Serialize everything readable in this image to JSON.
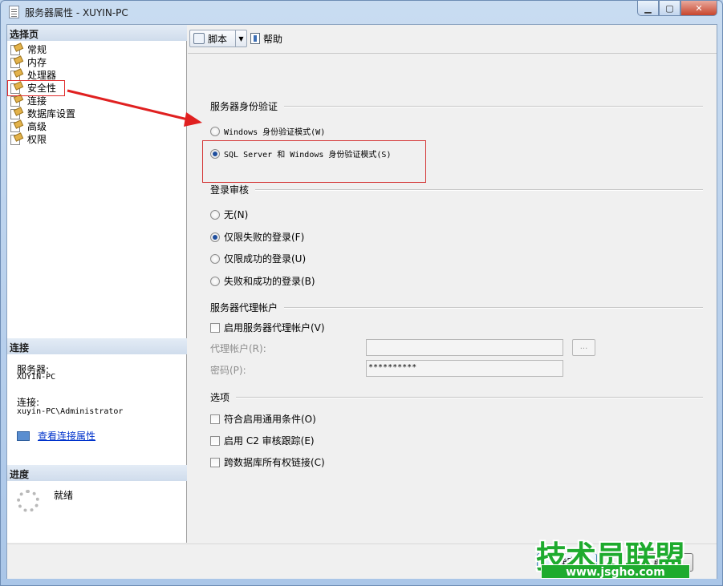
{
  "window": {
    "title": "服务器属性 - XUYIN-PC",
    "minimize_glyph": "▁",
    "maximize_glyph": "▢",
    "close_glyph": "✕"
  },
  "left_panel": {
    "select_page_header": "选择页",
    "pages": [
      {
        "label": "常规"
      },
      {
        "label": "内存"
      },
      {
        "label": "处理器"
      },
      {
        "label": "安全性"
      },
      {
        "label": "连接"
      },
      {
        "label": "数据库设置"
      },
      {
        "label": "高级"
      },
      {
        "label": "权限"
      }
    ],
    "connection_header": "连接",
    "server_label": "服务器:",
    "server_value": "XUYIN-PC",
    "connection_label": "连接:",
    "connection_value": "xuyin-PC\\Administrator",
    "view_connection_props": "查看连接属性",
    "progress_header": "进度",
    "progress_status": "就绪"
  },
  "toolbar": {
    "script_label": "脚本",
    "help_label": "帮助"
  },
  "form": {
    "auth_group": "服务器身份验证",
    "auth_windows": "Windows 身份验证模式(W)",
    "auth_mixed": "SQL Server 和 Windows 身份验证模式(S)",
    "audit_group": "登录审核",
    "audit_none": "无(N)",
    "audit_failed": "仅限失败的登录(F)",
    "audit_success": "仅限成功的登录(U)",
    "audit_both": "失败和成功的登录(B)",
    "proxy_group": "服务器代理帐户",
    "proxy_enable": "启用服务器代理帐户(V)",
    "proxy_account_label": "代理帐户(R):",
    "proxy_account_value": "",
    "password_label": "密码(P):",
    "password_value": "**********",
    "browse_label": "...",
    "options_group": "选项",
    "opt_common_criteria": "符合启用通用条件(O)",
    "opt_c2_audit": "启用 C2 审核跟踪(E)",
    "opt_cross_db": "跨数据库所有权链接(C)"
  },
  "buttons": {
    "ok": "确定",
    "cancel": "取消"
  },
  "watermark": {
    "title": "技术员联盟",
    "url": "www.jsgho.com"
  }
}
